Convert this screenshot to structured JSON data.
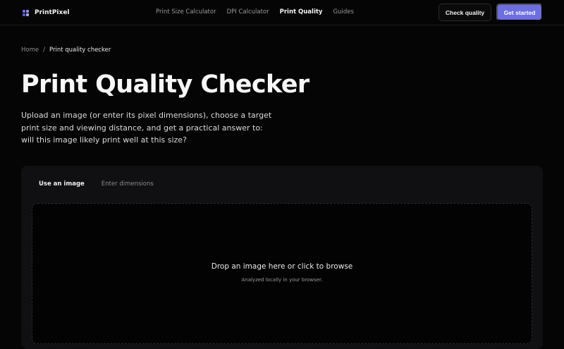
{
  "header": {
    "brand_name": "PrintPixel",
    "brand_colors": [
      "#6d6ee0",
      "#8b8cf0",
      "#5a5bd0",
      "#a7a8f5"
    ],
    "nav": [
      {
        "label": "Print Size Calculator",
        "active": false
      },
      {
        "label": "DPI Calculator",
        "active": false
      },
      {
        "label": "Print Quality",
        "active": true
      },
      {
        "label": "Guides",
        "active": false
      }
    ],
    "check_quality_label": "Check quality",
    "get_started_label": "Get started",
    "accent_color": "#6d6ee0"
  },
  "breadcrumb": {
    "home": "Home",
    "separator": "/",
    "current": "Print quality checker"
  },
  "page": {
    "title": "Print Quality Checker",
    "intro": "Upload an image (or enter its pixel dimensions), choose a target print size and viewing distance, and get a practical answer to: will this image likely print well at this size?"
  },
  "checker": {
    "tabs": [
      {
        "label": "Use an image",
        "active": true
      },
      {
        "label": "Enter dimensions",
        "active": false
      }
    ],
    "dropzone_title": "Drop an image here or click to browse",
    "dropzone_subtitle": "Analyzed locally in your browser."
  }
}
